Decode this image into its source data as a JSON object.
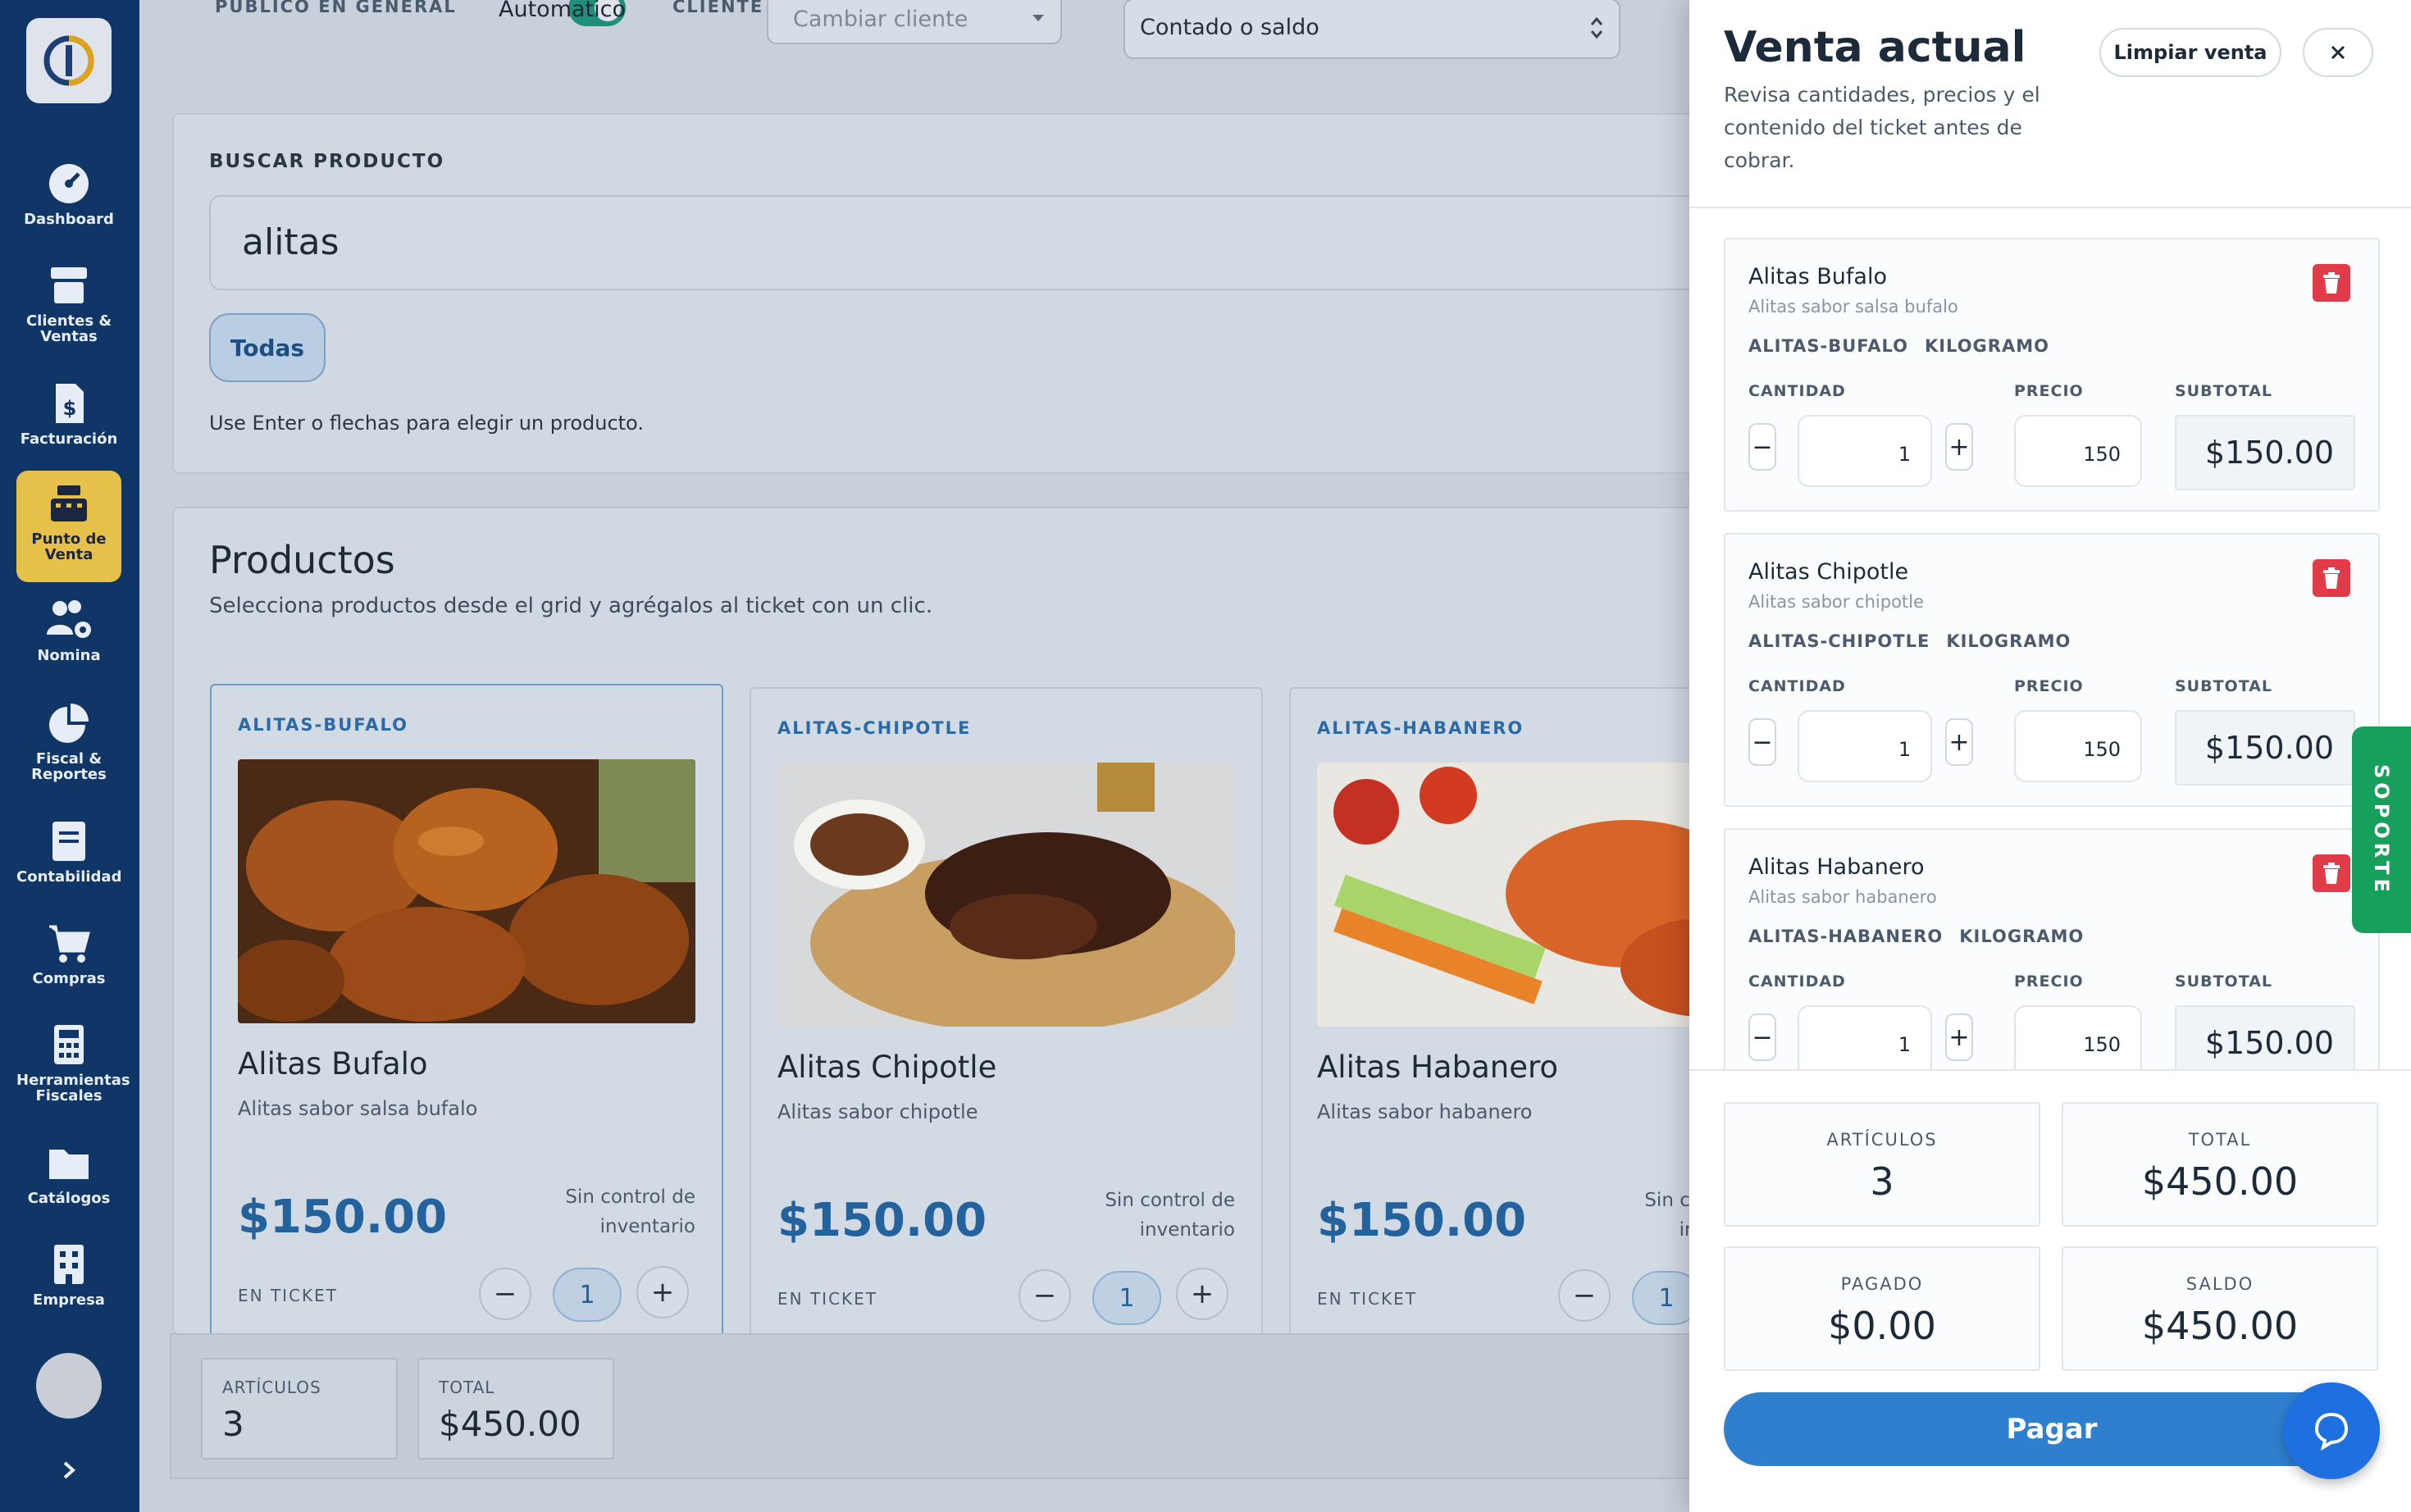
{
  "sidebar": {
    "items": [
      {
        "label": "Dashboard",
        "icon": "gauge-icon"
      },
      {
        "label": "Clientes & Ventas",
        "icon": "store-icon"
      },
      {
        "label": "Facturación",
        "icon": "invoice-icon"
      },
      {
        "label": "Punto de Venta",
        "icon": "cash-register-icon",
        "active": true
      },
      {
        "label": "Nomina",
        "icon": "users-gear-icon"
      },
      {
        "label": "Fiscal & Reportes",
        "icon": "pie-chart-icon"
      },
      {
        "label": "Contabilidad",
        "icon": "ledger-icon"
      },
      {
        "label": "Compras",
        "icon": "cart-icon"
      },
      {
        "label": "Herramientas Fiscales",
        "icon": "calculator-icon"
      },
      {
        "label": "Catálogos",
        "icon": "folder-icon"
      },
      {
        "label": "Empresa",
        "icon": "building-icon"
      }
    ]
  },
  "topbar": {
    "public_label": "PUBLICO EN GENERAL",
    "toggle_label": "Automatico",
    "client_label": "CLIENTE",
    "client_placeholder": "Cambiar cliente",
    "payment_method": "Contado o saldo"
  },
  "search": {
    "label": "BUSCAR PRODUCTO",
    "value": "alitas",
    "filter_chip": "Todas",
    "hint": "Use Enter o flechas para elegir un producto."
  },
  "products": {
    "title": "Productos",
    "subtitle": "Selecciona productos desde el grid y agrégalos al ticket con un clic.",
    "ticket_label": "EN TICKET",
    "stock_note": "Sin control de inventario",
    "items": [
      {
        "code": "ALITAS-BUFALO",
        "name": "Alitas Bufalo",
        "desc": "Alitas sabor salsa bufalo",
        "price": "$150.00",
        "qty": "1"
      },
      {
        "code": "ALITAS-CHIPOTLE",
        "name": "Alitas Chipotle",
        "desc": "Alitas sabor chipotle",
        "price": "$150.00",
        "qty": "1"
      },
      {
        "code": "ALITAS-HABANERO",
        "name": "Alitas Habanero",
        "desc": "Alitas sabor habanero",
        "price": "$150.00",
        "qty": "1"
      }
    ]
  },
  "bottom_summary": {
    "articles_label": "ARTÍCULOS",
    "articles_value": "3",
    "total_label": "TOTAL",
    "total_value": "$450.00"
  },
  "panel": {
    "title": "Venta actual",
    "subtitle": "Revisa cantidades, precios y el contenido del ticket antes de cobrar.",
    "clear_button": "Limpiar venta",
    "qty_label": "CANTIDAD",
    "price_label": "PRECIO",
    "subtotal_label": "SUBTOTAL",
    "unit": "KILOGRAMO",
    "items": [
      {
        "name": "Alitas Bufalo",
        "desc": "Alitas sabor salsa bufalo",
        "code": "ALITAS-BUFALO",
        "qty": "1",
        "price": "150",
        "subtotal": "$150.00"
      },
      {
        "name": "Alitas Chipotle",
        "desc": "Alitas sabor chipotle",
        "code": "ALITAS-CHIPOTLE",
        "qty": "1",
        "price": "150",
        "subtotal": "$150.00"
      },
      {
        "name": "Alitas Habanero",
        "desc": "Alitas sabor habanero",
        "code": "ALITAS-HABANERO",
        "qty": "1",
        "price": "150",
        "subtotal": "$150.00"
      }
    ],
    "summary": {
      "articles_label": "ARTÍCULOS",
      "articles_value": "3",
      "total_label": "TOTAL",
      "total_value": "$450.00",
      "paid_label": "PAGADO",
      "paid_value": "$0.00",
      "balance_label": "SALDO",
      "balance_value": "$450.00"
    },
    "pay_button": "Pagar",
    "support_tab": "SOPORTE"
  },
  "colors": {
    "sidebar_bg": "#103667",
    "active_nav": "#e6c14a",
    "accent_blue": "#2f7fcf",
    "delete_red": "#e13a48",
    "support_green": "#17a05b"
  }
}
